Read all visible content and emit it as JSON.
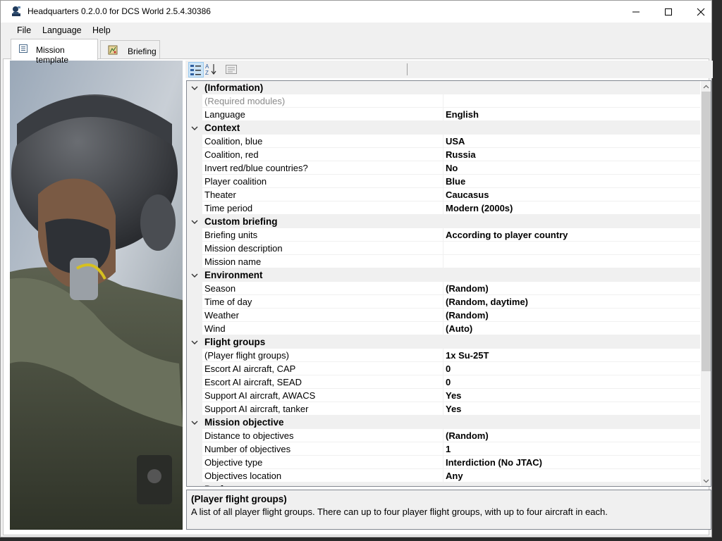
{
  "window": {
    "title": "Headquarters 0.2.0.0 for DCS World 2.5.4.30386",
    "icons": {
      "app": "hq-logo-icon",
      "minimize": "minimize-icon",
      "maximize": "maximize-icon",
      "close": "close-icon"
    }
  },
  "menu": {
    "items": [
      {
        "label": "File"
      },
      {
        "label": "Language"
      },
      {
        "label": "Help"
      }
    ]
  },
  "tabs": [
    {
      "label": "Mission template",
      "icon": "document-icon",
      "active": true
    },
    {
      "label": "Briefing",
      "icon": "map-icon",
      "active": false
    }
  ],
  "toolbar": {
    "buttons": [
      {
        "icon": "categorized-view-icon",
        "active": true
      },
      {
        "icon": "sort-az-icon",
        "active": false
      },
      {
        "icon": "property-pages-icon",
        "active": false
      }
    ]
  },
  "image": {
    "subject": "pilot-portrait"
  },
  "properties": [
    {
      "type": "category",
      "name": "(Information)"
    },
    {
      "type": "prop",
      "name": "(Required modules)",
      "value": "",
      "readonly": true
    },
    {
      "type": "prop",
      "name": "Language",
      "value": "English"
    },
    {
      "type": "category",
      "name": "Context"
    },
    {
      "type": "prop",
      "name": "Coalition, blue",
      "value": "USA"
    },
    {
      "type": "prop",
      "name": "Coalition, red",
      "value": "Russia"
    },
    {
      "type": "prop",
      "name": "Invert red/blue countries?",
      "value": "No"
    },
    {
      "type": "prop",
      "name": "Player coalition",
      "value": "Blue"
    },
    {
      "type": "prop",
      "name": "Theater",
      "value": "Caucasus"
    },
    {
      "type": "prop",
      "name": "Time period",
      "value": "Modern (2000s)"
    },
    {
      "type": "category",
      "name": "Custom briefing"
    },
    {
      "type": "prop",
      "name": "Briefing units",
      "value": "According to player country"
    },
    {
      "type": "prop",
      "name": "Mission description",
      "value": ""
    },
    {
      "type": "prop",
      "name": "Mission name",
      "value": ""
    },
    {
      "type": "category",
      "name": "Environment"
    },
    {
      "type": "prop",
      "name": "Season",
      "value": "(Random)"
    },
    {
      "type": "prop",
      "name": "Time of day",
      "value": "(Random, daytime)"
    },
    {
      "type": "prop",
      "name": "Weather",
      "value": "(Random)"
    },
    {
      "type": "prop",
      "name": "Wind",
      "value": "(Auto)"
    },
    {
      "type": "category",
      "name": "Flight groups"
    },
    {
      "type": "prop",
      "name": "(Player flight groups)",
      "value": "1x Su-25T"
    },
    {
      "type": "prop",
      "name": "Escort AI aircraft, CAP",
      "value": "0"
    },
    {
      "type": "prop",
      "name": "Escort AI aircraft, SEAD",
      "value": "0"
    },
    {
      "type": "prop",
      "name": "Support AI aircraft, AWACS",
      "value": "Yes"
    },
    {
      "type": "prop",
      "name": "Support AI aircraft, tanker",
      "value": "Yes"
    },
    {
      "type": "category",
      "name": "Mission objective"
    },
    {
      "type": "prop",
      "name": "Distance to objectives",
      "value": "(Random)"
    },
    {
      "type": "prop",
      "name": "Number of objectives",
      "value": "1"
    },
    {
      "type": "prop",
      "name": "Objective type",
      "value": "Interdiction (No JTAC)"
    },
    {
      "type": "prop",
      "name": "Objectives location",
      "value": "Any"
    },
    {
      "type": "category",
      "name": "Pref..."
    }
  ],
  "help": {
    "title": "(Player flight groups)",
    "description": "A list of all player flight groups. There can up to four player flight groups, with up to four aircraft in each."
  },
  "colors": {
    "category_bg": "#f0f0f0",
    "selected_button": "#cce4f7",
    "window_bg": "#f0f0f0"
  }
}
